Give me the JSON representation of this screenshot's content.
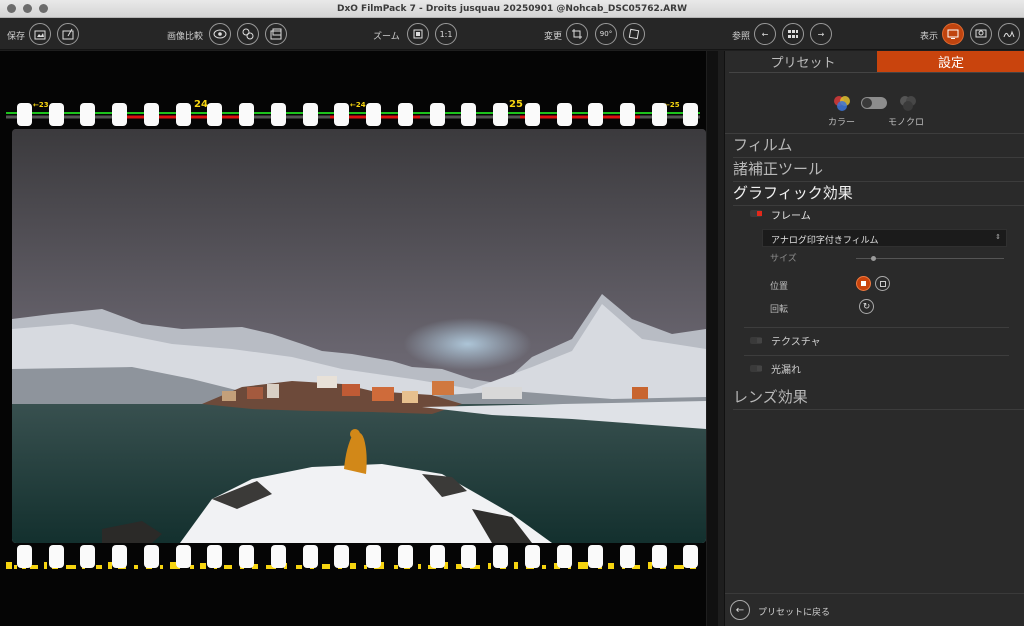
{
  "window": {
    "title": "DxO FilmPack 7 - Droits jusquau 20250901 @Nohcab_DSC05762.ARW"
  },
  "toolbar": {
    "save_label": "保存",
    "compare_label": "画像比較",
    "zoom_label": "ズーム",
    "zoom_value": "1:1",
    "transform_label": "変更",
    "rotate_90": "90°",
    "browse_label": "参照",
    "display_label": "表示"
  },
  "film_strip": {
    "top_frame_labels": [
      "←23",
      "24",
      "←24",
      "25",
      "←25"
    ]
  },
  "panel": {
    "tabs": [
      "プリセット",
      "設定"
    ],
    "color_label": "カラー",
    "mono_label": "モノクロ",
    "sections": {
      "film": "フィルム",
      "correction": "諸補正ツール",
      "graphic": "グラフィック効果",
      "lens": "レンズ効果"
    },
    "frame": {
      "label": "フレーム",
      "selected_type": "アナログ印字付きフィルム",
      "size_label": "サイズ",
      "position_label": "位置",
      "rotation_label": "回転"
    },
    "texture_label": "テクスチャ",
    "light_leak_label": "光漏れ",
    "back_to_presets": "プリセットに戻る"
  }
}
